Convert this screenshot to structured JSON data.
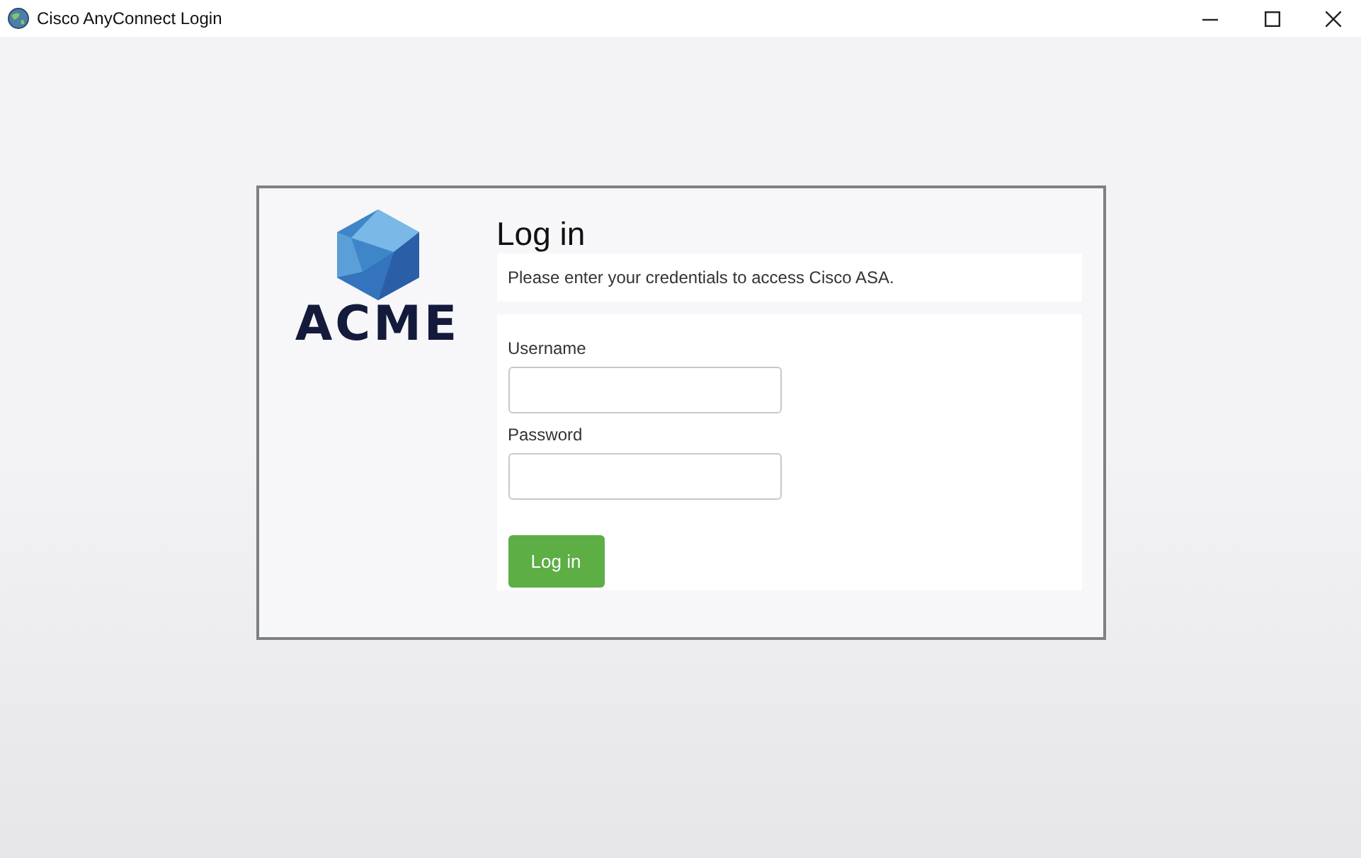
{
  "window": {
    "title": "Cisco AnyConnect Login"
  },
  "logo": {
    "text": "ACME"
  },
  "heading": "Log in",
  "message": "Please enter your credentials to access Cisco ASA.",
  "fields": [
    {
      "label": "Username"
    },
    {
      "label": "Password"
    }
  ],
  "submit": "Log in"
}
